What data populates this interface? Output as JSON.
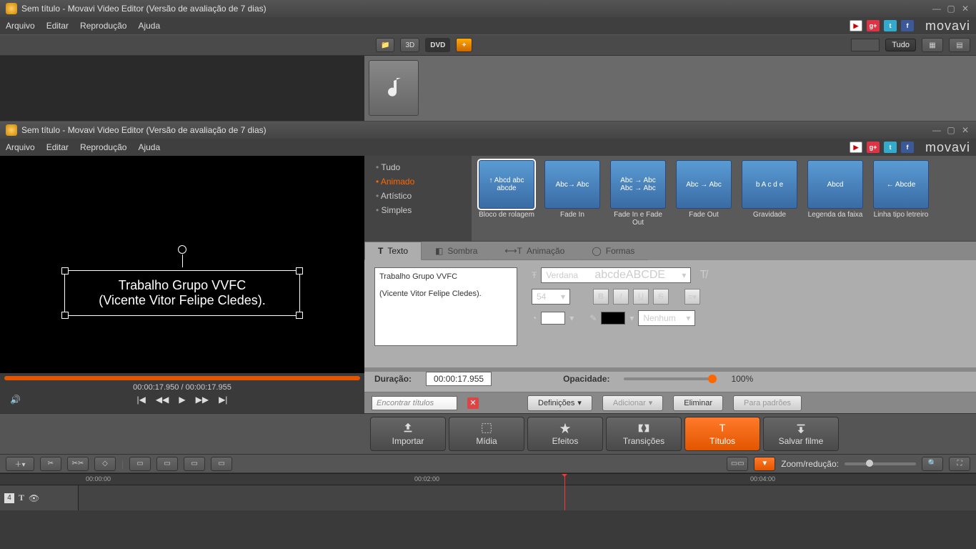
{
  "window": {
    "title": "Sem título - Movavi Video Editor (Versão de avaliação de 7 dias)"
  },
  "menu": {
    "items": [
      "Arquivo",
      "Editar",
      "Reprodução",
      "Ajuda"
    ],
    "brand": "movavi"
  },
  "toolbar_upper": {
    "btn_3d": "3D",
    "btn_dvd": "DVD",
    "btn_tudo": "Tudo"
  },
  "preview": {
    "line1": "Trabalho Grupo VVFC",
    "line2": "(Vicente Vitor Felipe Cledes).",
    "time_current": "00:00:17.950",
    "time_total": "00:00:17.955"
  },
  "filter_categories": {
    "all": "Tudo",
    "animated": "Animado",
    "artistic": "Artístico",
    "simple": "Simples"
  },
  "title_thumbs": [
    {
      "chip": "↑\nAbcd\nabc\nabcde",
      "label": "Bloco de rolagem"
    },
    {
      "chip": "Abc→ Abc",
      "label": "Fade In"
    },
    {
      "chip": "Abc → Abc\nAbc → Abc",
      "label": "Fade In e Fade Out"
    },
    {
      "chip": "Abc → Abc",
      "label": "Fade Out"
    },
    {
      "chip": "b\nA c d e",
      "label": "Gravidade"
    },
    {
      "chip": "Abcd",
      "label": "Legenda da faixa"
    },
    {
      "chip": "← Abcde",
      "label": "Linha tipo letreiro"
    }
  ],
  "prop_tabs": {
    "text": "Texto",
    "shadow": "Sombra",
    "animation": "Animação",
    "shapes": "Formas"
  },
  "text_props": {
    "font_name": "Verdana",
    "font_sample": "abcdeABCDE",
    "font_size": "54",
    "outline": "Nenhum",
    "duration_label": "Duração:",
    "duration_value": "00:00:17.955",
    "opacity_label": "Opacidade:",
    "opacity_value": "100%",
    "text_line1": "Trabalho Grupo VVFC",
    "text_line2": "(Vicente Vitor Felipe Cledes)."
  },
  "action_bar": {
    "search_placeholder": "Encontrar títulos",
    "definitions": "Definições",
    "add": "Adicionar",
    "remove": "Eliminar",
    "defaults": "Para padrões"
  },
  "navbtns": {
    "import": "Importar",
    "media": "Mídia",
    "effects": "Efeitos",
    "transitions": "Transições",
    "titles": "Títulos",
    "save": "Salvar filme"
  },
  "timeline": {
    "zoom_label": "Zoom/redução:",
    "ticks": [
      "00:00:00",
      "00:02:00",
      "00:04:00"
    ],
    "track_num": "4"
  }
}
